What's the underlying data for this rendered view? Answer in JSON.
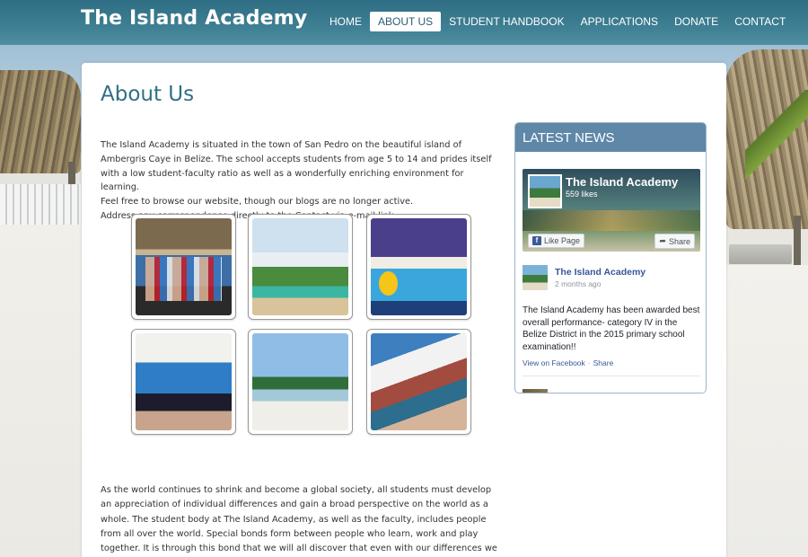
{
  "header": {
    "site_title": "The Island Academy",
    "nav": [
      {
        "label": "HOME",
        "active": false
      },
      {
        "label": "ABOUT US",
        "active": true
      },
      {
        "label": "STUDENT HANDBOOK",
        "active": false
      },
      {
        "label": "APPLICATIONS",
        "active": false
      },
      {
        "label": "DONATE",
        "active": false
      },
      {
        "label": "CONTACT",
        "active": false
      }
    ]
  },
  "main": {
    "page_title": "About Us",
    "intro": [
      "The Island Academy is situated in the town of San Pedro on the beautiful island of Ambergris Caye in Belize. The school accepts students from age 5 to 14 and prides itself with a low student-faculty ratio as well as a wonderfully enriching environment for learning.",
      "Feel free to browse our website, though our blogs are no longer active.",
      "Address any correspondence directly to the Contact via e-mail link."
    ],
    "gallery": [
      {
        "icon": "group-of-students-photo"
      },
      {
        "icon": "school-building-photo"
      },
      {
        "icon": "school-sign-photo"
      },
      {
        "icon": "students-in-classroom-photo"
      },
      {
        "icon": "beach-palm-trees-photo"
      },
      {
        "icon": "students-at-table-photo"
      }
    ],
    "body_text": "As the world continues to shrink and become a global society, all students must develop an appreciation of individual differences and gain a broad perspective on the world as a whole. The student body at The Island Academy, as well as the faculty, includes people from all over the world. Special bonds form between people who learn, work and play together. It is through this bond that we will all discover that even with our differences we are all very much alike. At The Island Academy, students are encouraged to"
  },
  "news": {
    "heading": "LATEST NEWS",
    "page_name": "The Island Academy",
    "likes": "559 likes",
    "like_page_label": "Like Page",
    "share_label": "Share",
    "post": {
      "author": "The Island Academy",
      "time": "2 months ago",
      "body": "The Island Academy has been awarded best overall performance- category IV in the Belize District in the 2015 primary school examination!!",
      "view_link": "View on Facebook",
      "share_link": "Share"
    }
  },
  "colors": {
    "header_bg": "#3e7f93",
    "title_color": "#2f6f86",
    "news_header_bg": "#5f87a8",
    "facebook_link": "#365899"
  }
}
